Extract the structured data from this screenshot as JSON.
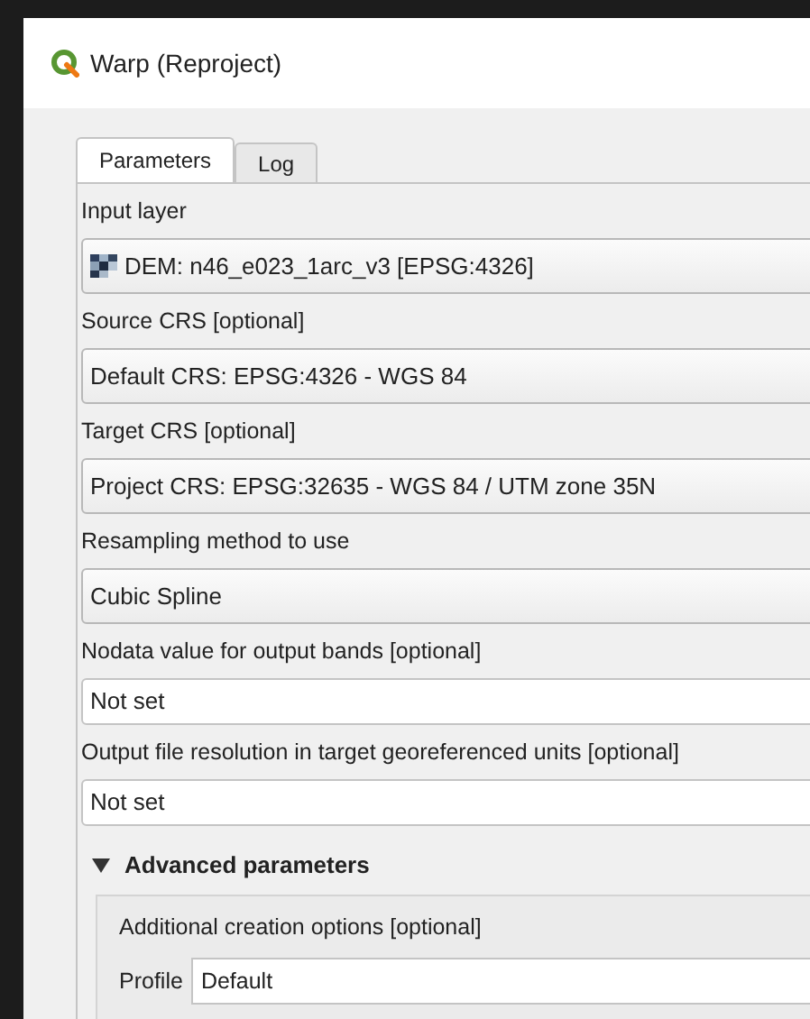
{
  "window": {
    "title": "Warp (Reproject)"
  },
  "tabs": [
    {
      "label": "Parameters",
      "selected": true
    },
    {
      "label": "Log",
      "selected": false
    }
  ],
  "parameters": [
    {
      "label": "Input layer",
      "kind": "layer",
      "value": "DEM: n46_e023_1arc_v3 [EPSG:4326]"
    },
    {
      "label": "Source CRS [optional]",
      "kind": "combo",
      "value": "Default CRS: EPSG:4326 - WGS 84"
    },
    {
      "label": "Target CRS [optional]",
      "kind": "combo",
      "value": "Project CRS: EPSG:32635 - WGS 84 / UTM zone 35N"
    },
    {
      "label": "Resampling method to use",
      "kind": "combo",
      "value": "Cubic Spline"
    },
    {
      "label": "Nodata value for output bands [optional]",
      "kind": "text",
      "value": "Not set"
    },
    {
      "label": "Output file resolution in target georeferenced units [optional]",
      "kind": "text",
      "value": "Not set"
    }
  ],
  "advanced": {
    "title": "Advanced parameters",
    "expanded": true,
    "options_label": "Additional creation options [optional]",
    "profile_label": "Profile",
    "profile_value": "Default"
  }
}
